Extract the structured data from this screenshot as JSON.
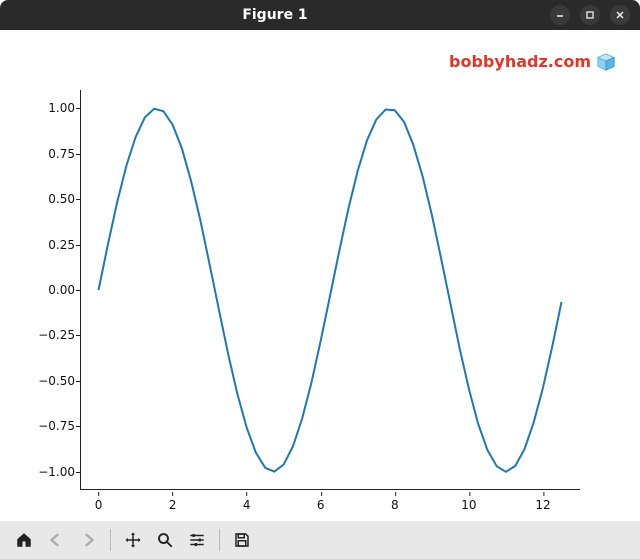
{
  "window": {
    "title": "Figure 1"
  },
  "watermark": {
    "text": "bobbyhadz.com"
  },
  "chart_data": {
    "type": "line",
    "title": "",
    "xlabel": "",
    "ylabel": "",
    "xlim": [
      -0.5,
      13.0
    ],
    "ylim": [
      -1.1,
      1.1
    ],
    "xticks": [
      0,
      2,
      4,
      6,
      8,
      10,
      12
    ],
    "yticks": [
      -1.0,
      -0.75,
      -0.5,
      -0.25,
      0.0,
      0.25,
      0.5,
      0.75,
      1.0
    ],
    "x": [
      0.0,
      0.25,
      0.5,
      0.75,
      1.0,
      1.25,
      1.5,
      1.75,
      2.0,
      2.25,
      2.5,
      2.75,
      3.0,
      3.25,
      3.5,
      3.75,
      4.0,
      4.25,
      4.5,
      4.75,
      5.0,
      5.25,
      5.5,
      5.75,
      6.0,
      6.25,
      6.5,
      6.75,
      7.0,
      7.25,
      7.5,
      7.75,
      8.0,
      8.25,
      8.5,
      8.75,
      9.0,
      9.25,
      9.5,
      9.75,
      10.0,
      10.25,
      10.5,
      10.75,
      11.0,
      11.25,
      11.5,
      11.75,
      12.0,
      12.25,
      12.5
    ],
    "y": [
      0.0,
      0.247,
      0.479,
      0.682,
      0.841,
      0.949,
      0.997,
      0.984,
      0.909,
      0.778,
      0.599,
      0.382,
      0.141,
      -0.108,
      -0.351,
      -0.572,
      -0.757,
      -0.895,
      -0.978,
      -0.999,
      -0.959,
      -0.859,
      -0.706,
      -0.508,
      -0.279,
      -0.033,
      0.215,
      0.45,
      0.657,
      0.823,
      0.938,
      0.993,
      0.989,
      0.924,
      0.799,
      0.625,
      0.412,
      0.174,
      -0.075,
      -0.32,
      -0.544,
      -0.735,
      -0.88,
      -0.969,
      -1.0,
      -0.968,
      -0.876,
      -0.728,
      -0.537,
      -0.312,
      -0.066
    ],
    "line_color": "#1f77b4"
  },
  "yticks_fmt": [
    "−1.00",
    "−0.75",
    "−0.50",
    "−0.25",
    "0.00",
    "0.25",
    "0.50",
    "0.75",
    "1.00"
  ],
  "xticks_fmt": [
    "0",
    "2",
    "4",
    "6",
    "8",
    "10",
    "12"
  ],
  "toolbar": {
    "home": "Home",
    "back": "Back",
    "forward": "Forward",
    "pan": "Pan",
    "zoom": "Zoom",
    "config": "Configure subplots",
    "save": "Save"
  }
}
